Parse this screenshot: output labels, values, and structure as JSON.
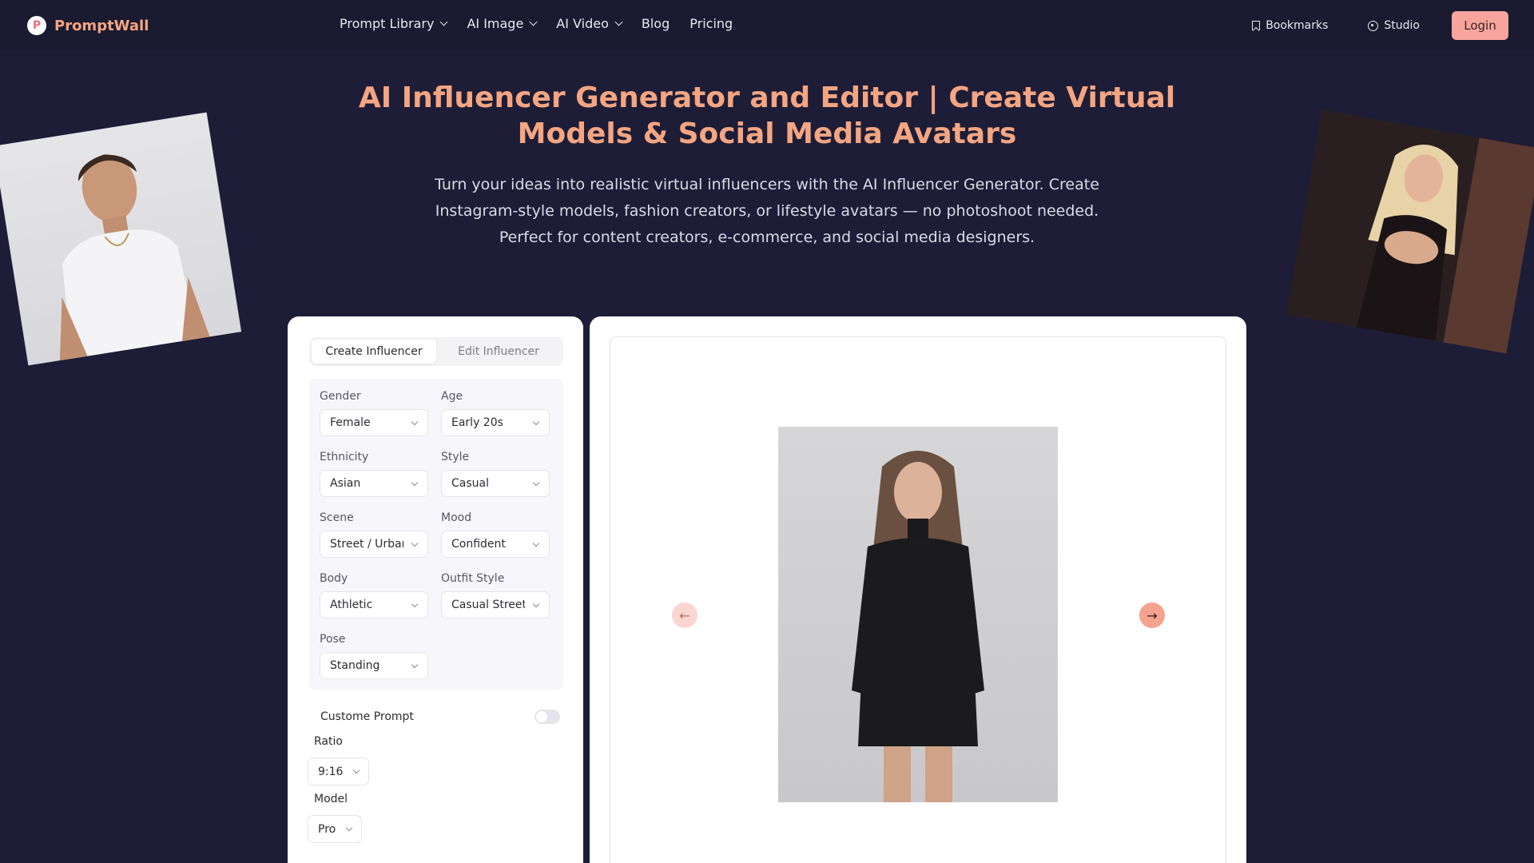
{
  "nav": {
    "logo_mark": "P",
    "logo_text": "PromptWall",
    "links": [
      {
        "label": "Prompt Library"
      },
      {
        "label": "AI Image"
      },
      {
        "label": "AI Video"
      },
      {
        "label": "Blog"
      },
      {
        "label": "Pricing"
      }
    ],
    "bookmarks": "Bookmarks",
    "studio": "Studio",
    "login": "Login"
  },
  "hero": {
    "title_line1": "AI Influencer Generator and Editor | Create Virtual",
    "title_line2": "Models & Social Media Avatars",
    "sub_line1": "Turn your ideas into realistic virtual influencers with the AI Influencer Generator. Create",
    "sub_line2": "Instagram-style models, fashion creators, or lifestyle avatars — no photoshoot needed.",
    "sub_line3": "Perfect for content creators, e-commerce, and social media designers."
  },
  "tabs": {
    "create": "Create Influencer",
    "edit": "Edit Influencer"
  },
  "fields": {
    "gender": {
      "label": "Gender",
      "value": "Female"
    },
    "age": {
      "label": "Age",
      "value": "Early 20s"
    },
    "ethnicity": {
      "label": "Ethnicity",
      "value": "Asian"
    },
    "style": {
      "label": "Style",
      "value": "Casual"
    },
    "scene": {
      "label": "Scene",
      "value": "Street / Urban"
    },
    "mood": {
      "label": "Mood",
      "value": "Confident"
    },
    "body": {
      "label": "Body",
      "value": "Athletic"
    },
    "outfit": {
      "label": "Outfit Style",
      "value": "Casual Streetwear"
    },
    "pose": {
      "label": "Pose",
      "value": "Standing"
    }
  },
  "custom_prompt": {
    "label": "Custome Prompt",
    "enabled": false
  },
  "ratio": {
    "label": "Ratio",
    "value": "9:16"
  },
  "model": {
    "label": "Model",
    "value": "Pro"
  },
  "colors": {
    "accent": "#f4a582",
    "login_bg": "#f7a59c",
    "page_bg": "#1e1d37",
    "nav_bg": "#1a1a30"
  },
  "icons": {
    "bookmark": "bookmark-icon",
    "studio": "palette-icon",
    "prev": "arrow-left-icon",
    "next": "arrow-right-icon"
  }
}
